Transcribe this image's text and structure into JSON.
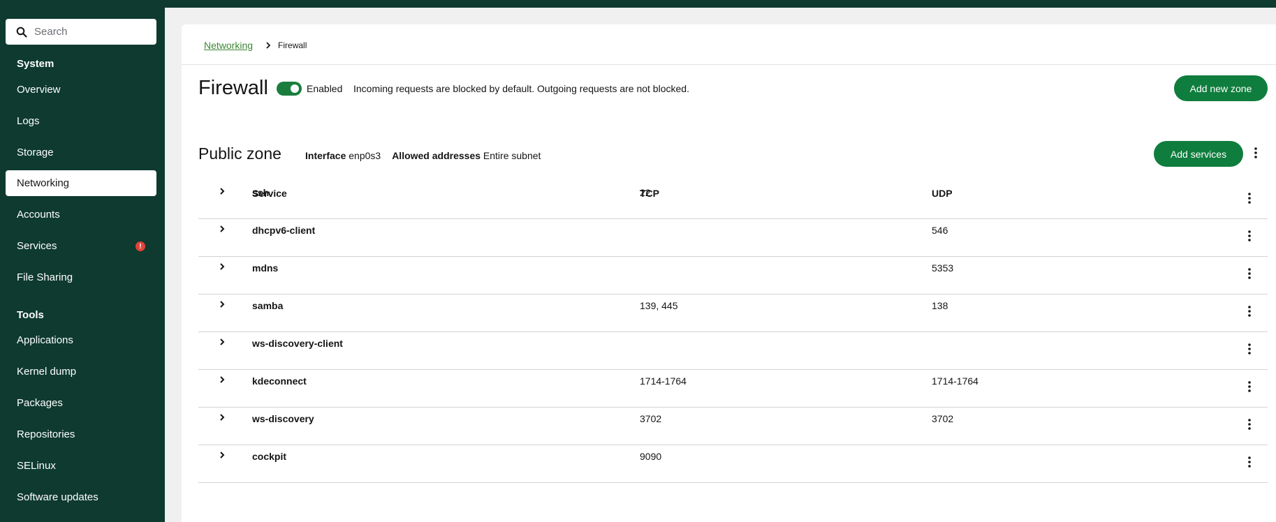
{
  "sidebar": {
    "search_placeholder": "Search",
    "system_section": "System",
    "system_items": [
      {
        "label": "Overview"
      },
      {
        "label": "Logs"
      },
      {
        "label": "Storage"
      },
      {
        "label": "Networking",
        "active": true
      },
      {
        "label": "Accounts"
      },
      {
        "label": "Services",
        "badge": "!"
      },
      {
        "label": "File Sharing"
      }
    ],
    "tools_section": "Tools",
    "tools_items": [
      {
        "label": "Applications"
      },
      {
        "label": "Kernel dump"
      },
      {
        "label": "Packages"
      },
      {
        "label": "Repositories"
      },
      {
        "label": "SELinux"
      },
      {
        "label": "Software updates"
      }
    ]
  },
  "breadcrumb": {
    "parent": "Networking",
    "current": "Firewall"
  },
  "firewall": {
    "title": "Firewall",
    "enabled": true,
    "toggle_label": "Enabled",
    "description": "Incoming requests are blocked by default. Outgoing requests are not blocked.",
    "add_zone_label": "Add new zone"
  },
  "zone": {
    "title": "Public zone",
    "interface_label": "Interface",
    "interface_value": "enp0s3",
    "allowed_label": "Allowed addresses",
    "allowed_value": "Entire subnet",
    "add_services_label": "Add services"
  },
  "table": {
    "headers": {
      "service": "Service",
      "tcp": "TCP",
      "udp": "UDP"
    },
    "rows": [
      {
        "service": "ssh",
        "tcp": "22",
        "udp": ""
      },
      {
        "service": "dhcpv6-client",
        "tcp": "",
        "udp": "546"
      },
      {
        "service": "mdns",
        "tcp": "",
        "udp": "5353"
      },
      {
        "service": "samba",
        "tcp": "139, 445",
        "udp": "138"
      },
      {
        "service": "ws-discovery-client",
        "tcp": "",
        "udp": ""
      },
      {
        "service": "kdeconnect",
        "tcp": "1714-1764",
        "udp": "1714-1764"
      },
      {
        "service": "ws-discovery",
        "tcp": "3702",
        "udp": "3702"
      },
      {
        "service": "cockpit",
        "tcp": "9090",
        "udp": ""
      }
    ]
  },
  "colors": {
    "sidebar_bg": "#0e3a2f",
    "accent_green": "#0f7d3d",
    "link_green": "#3e8635",
    "badge_red": "#e0443a"
  }
}
